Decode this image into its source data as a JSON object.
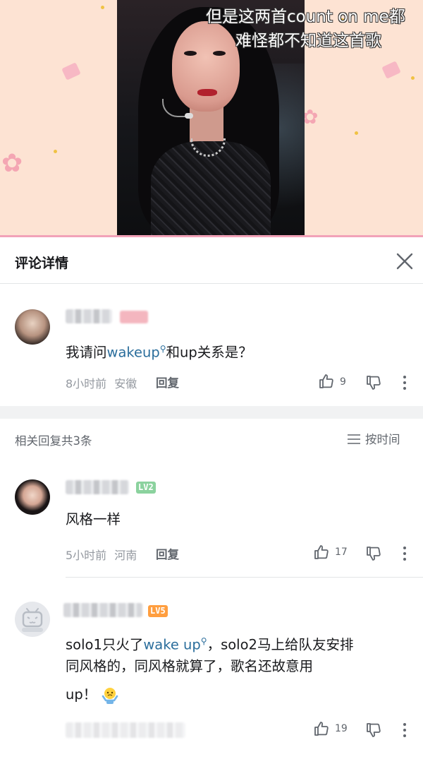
{
  "video": {
    "subtitle_line1": "但是这两首count on me都",
    "subtitle_line2": "难怪都不知道这首歌"
  },
  "header": {
    "title": "评论详情",
    "close_icon": "close-icon"
  },
  "root_comment": {
    "text_before": "我请问",
    "link_text": "wakeup",
    "text_after": "和up关系是？",
    "time": "8小时前",
    "location": "安徽",
    "reply_label": "回复",
    "likes": "9"
  },
  "replies_section": {
    "title": "相关回复共3条",
    "sort_label": "按时间"
  },
  "replies": [
    {
      "level": "LV2",
      "text": "风格一样",
      "time": "5小时前",
      "location": "河南",
      "reply_label": "回复",
      "likes": "17"
    },
    {
      "level": "LV5",
      "text_before": "solo1只火了",
      "link_text": "wake up",
      "text_after": "，solo2马上给队友安排",
      "line2": "同风格的，同风格就算了，歌名还故意用",
      "line3": "up！",
      "likes": "19"
    }
  ],
  "colors": {
    "link": "#2b6e9c",
    "meta": "#9499a0",
    "video_bg": "#fde3d3"
  }
}
